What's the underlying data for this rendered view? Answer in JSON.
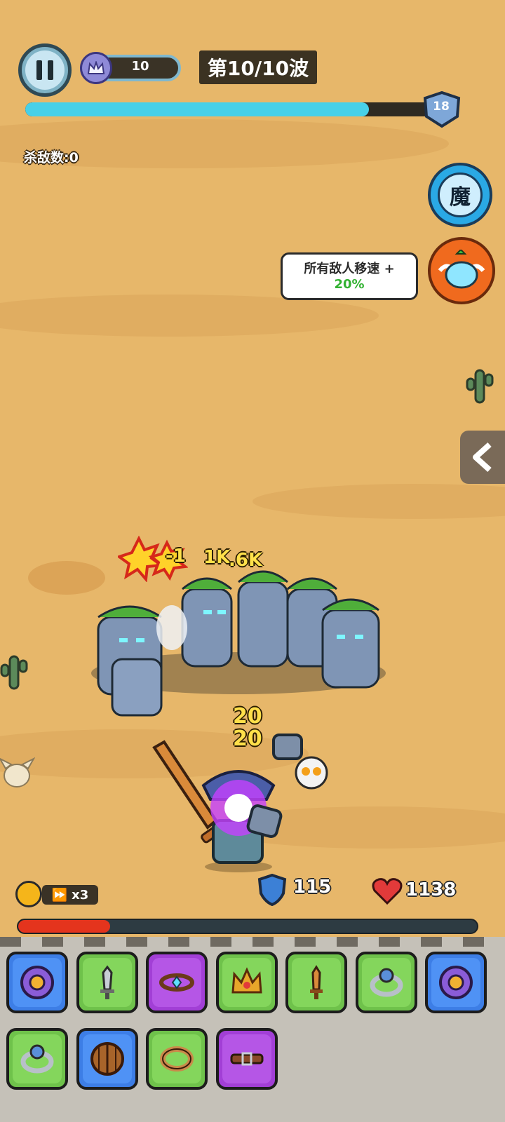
{
  "hud": {
    "crown_count": "10",
    "wave_label": "第10/10波",
    "wave_progress": 0.83,
    "level": "18",
    "kills_label": "杀敌数:0"
  },
  "side_buttons": {
    "magic_label": "魔",
    "buff_text_line1": "所有敌人移速 +",
    "buff_text_line2": "20%"
  },
  "battle": {
    "damage_texts": [
      "-1",
      "1K",
      ".6K"
    ],
    "hit_numbers": [
      "20",
      "20"
    ]
  },
  "bottom": {
    "speed_label": "x3",
    "shield": "115",
    "health": "1138",
    "hp_fraction": 0.2
  },
  "inventory": {
    "row1": [
      {
        "icon": "purple-shield-icon",
        "rarity": "blue"
      },
      {
        "icon": "iron-sword-icon",
        "rarity": "green"
      },
      {
        "icon": "gem-belt-icon",
        "rarity": "purple"
      },
      {
        "icon": "gold-crown-icon",
        "rarity": "green"
      },
      {
        "icon": "wooden-sword-icon",
        "rarity": "green"
      },
      {
        "icon": "silver-ring-icon",
        "rarity": "green"
      },
      {
        "icon": "purple-shield-icon",
        "rarity": "blue"
      }
    ],
    "row2": [
      {
        "icon": "silver-ring-icon",
        "rarity": "green"
      },
      {
        "icon": "wooden-shield-icon",
        "rarity": "blue"
      },
      {
        "icon": "bronze-ring-icon",
        "rarity": "green"
      },
      {
        "icon": "leather-belt-icon",
        "rarity": "purple"
      }
    ]
  }
}
